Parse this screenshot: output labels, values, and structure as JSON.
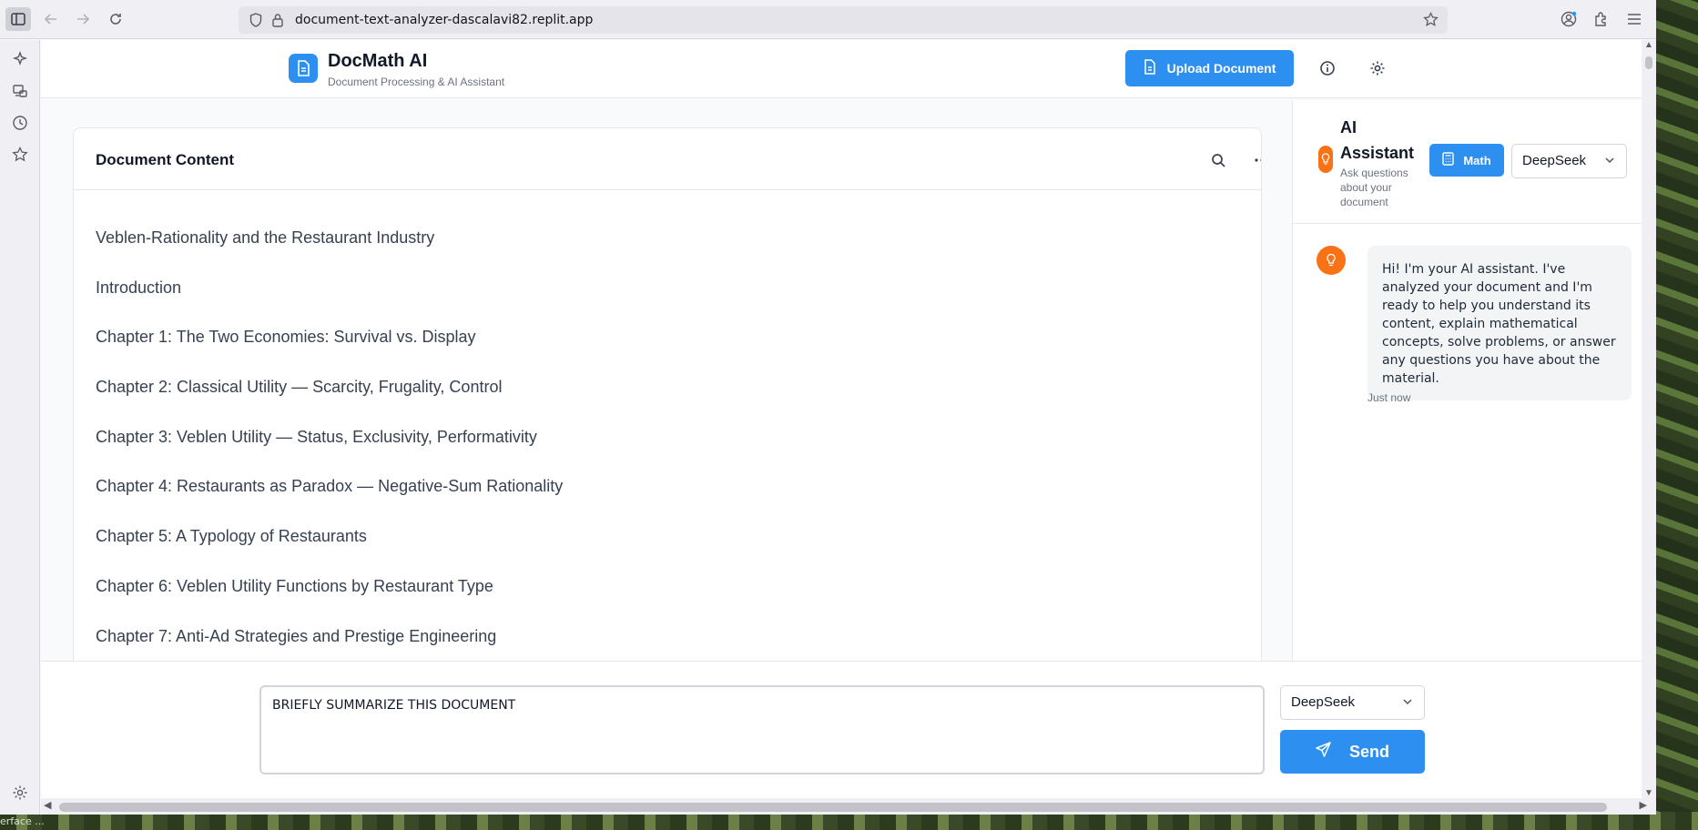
{
  "browser": {
    "url": "document-text-analyzer-dascalavi82.replit.app"
  },
  "app": {
    "name": "DocMath AI",
    "subtitle": "Document Processing & AI Assistant",
    "upload_label": "Upload Document"
  },
  "document": {
    "title": "Document Content",
    "lines": [
      "Veblen-Rationality and the Restaurant Industry",
      "Introduction",
      "Chapter 1: The Two Economies: Survival vs. Display",
      "Chapter 2: Classical Utility — Scarcity, Frugality, Control",
      "Chapter 3: Veblen Utility — Status, Exclusivity, Performativity",
      "Chapter 4: Restaurants as Paradox — Negative-Sum Rationality",
      "Chapter 5: A Typology of Restaurants",
      "Chapter 6: Veblen Utility Functions by Restaurant Type",
      "Chapter 7: Anti-Ad Strategies and Prestige Engineering"
    ]
  },
  "assistant": {
    "title": "AI Assistant",
    "subtitle": "Ask questions about your document",
    "math_label": "Math",
    "model": "DeepSeek",
    "message": "Hi! I'm your AI assistant. I've analyzed your document and I'm ready to help you understand its content, explain mathematical concepts, solve problems, or answer any questions you have about the material.",
    "message_time": "Just now"
  },
  "composer": {
    "input_value": "BRIEFLY SUMMARIZE THIS DOCUMENT",
    "model": "DeepSeek",
    "send_label": "Send"
  },
  "taskbar": {
    "text": "erface ..."
  },
  "colors": {
    "accent": "#2d8ff0",
    "assistant_avatar": "#f97316"
  }
}
